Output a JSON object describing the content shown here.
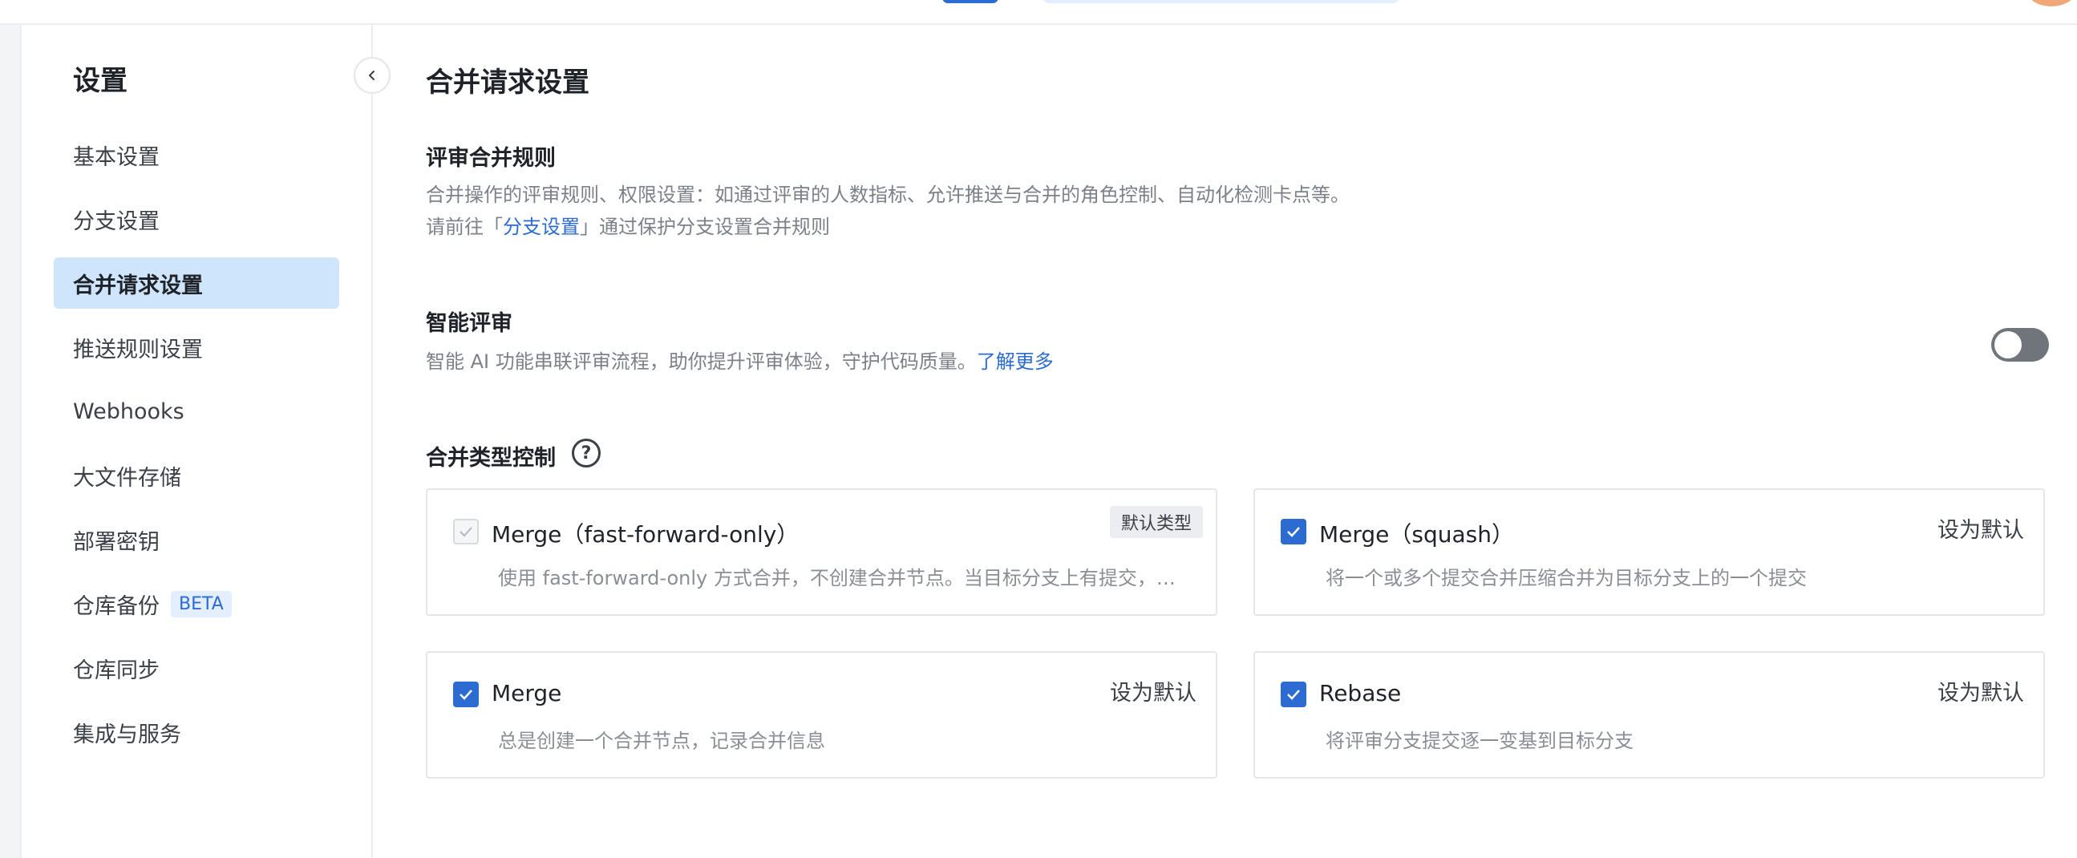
{
  "sidebar": {
    "title": "设置",
    "items": [
      {
        "label": "基本设置"
      },
      {
        "label": "分支设置"
      },
      {
        "label": "合并请求设置"
      },
      {
        "label": "推送规则设置"
      },
      {
        "label": "Webhooks"
      },
      {
        "label": "大文件存储"
      },
      {
        "label": "部署密钥"
      },
      {
        "label": "仓库备份",
        "badge": "BETA"
      },
      {
        "label": "仓库同步"
      },
      {
        "label": "集成与服务"
      }
    ],
    "active_index": 2
  },
  "main": {
    "title": "合并请求设置",
    "review_rules": {
      "title": "评审合并规则",
      "desc": "合并操作的评审规则、权限设置：如通过评审的人数指标、允许推送与合并的角色控制、自动化检测卡点等。",
      "goto_prefix": "请前往「",
      "goto_link": "分支设置",
      "goto_suffix": "」通过保护分支设置合并规则"
    },
    "smart_review": {
      "title": "智能评审",
      "desc": "智能 AI 功能串联评审流程，助你提升评审体验，守护代码质量。",
      "link": "了解更多",
      "enabled": false
    },
    "merge_types": {
      "title": "合并类型控制",
      "help_icon": "?",
      "cards": [
        {
          "title": "Merge（fast-forward-only）",
          "desc": "使用 fast-forward-only 方式合并，不创建合并节点。当目标分支上有提交，不...",
          "checked": true,
          "disabled": true,
          "tag": "默认类型"
        },
        {
          "title": "Merge（squash）",
          "desc": "将一个或多个提交合并压缩合并为目标分支上的一个提交",
          "checked": true,
          "action": "设为默认"
        },
        {
          "title": "Merge",
          "desc": "总是创建一个合并节点，记录合并信息",
          "checked": true,
          "action": "设为默认"
        },
        {
          "title": "Rebase",
          "desc": "将评审分支提交逐一变基到目标分支",
          "checked": true,
          "action": "设为默认"
        }
      ]
    }
  },
  "colors": {
    "accent": "#2c6bd1",
    "active_nav_bg": "#cfe5fb",
    "toggle_off": "#70747b"
  }
}
